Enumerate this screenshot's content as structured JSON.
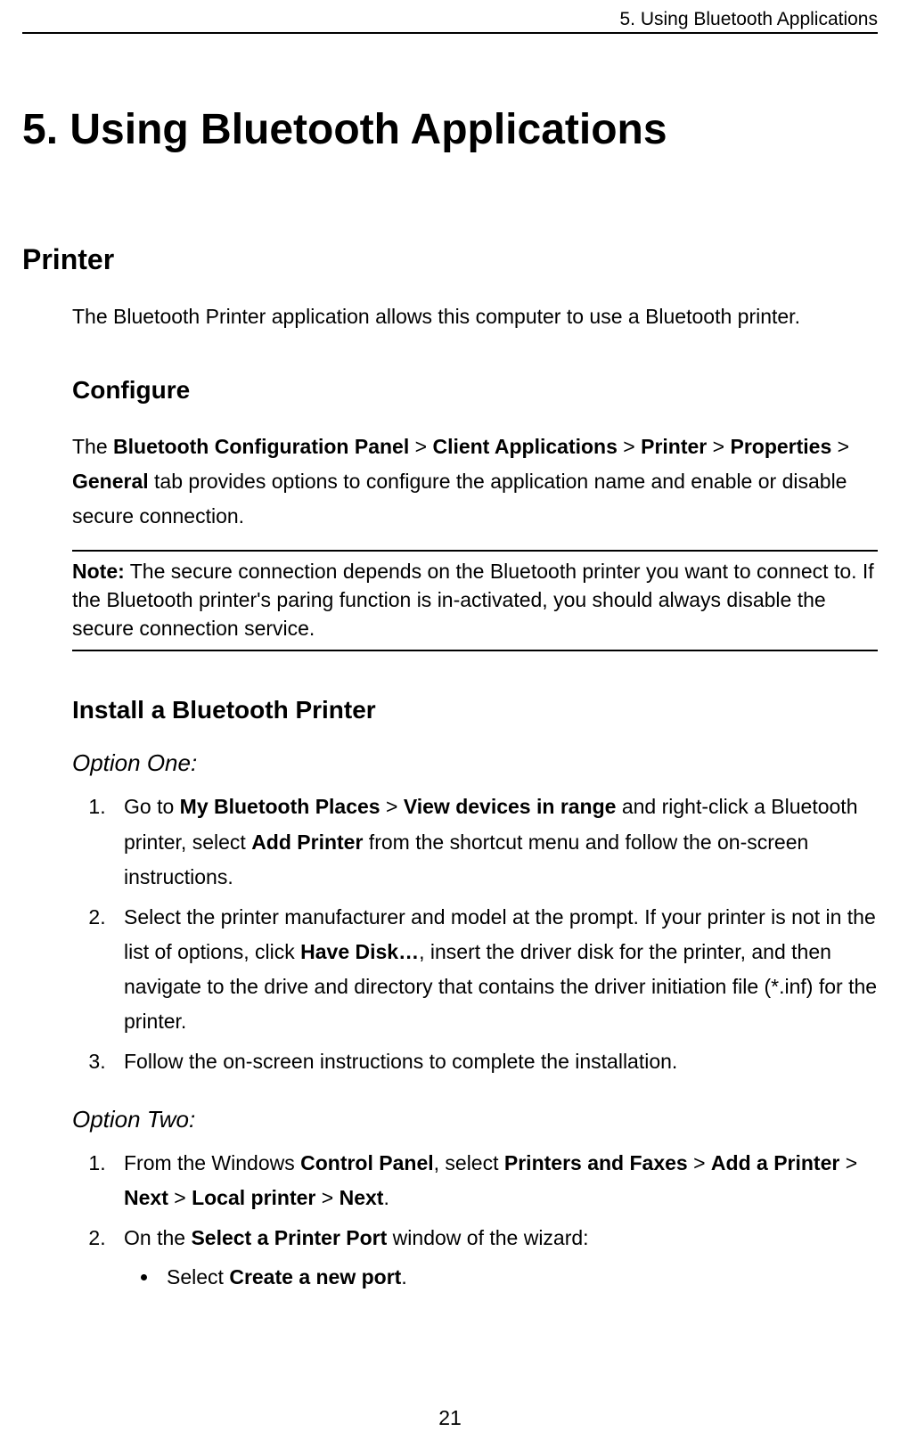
{
  "running_head": "5. Using Bluetooth Applications",
  "title": "5. Using Bluetooth Applications",
  "section_printer": "Printer",
  "printer_intro": "The Bluetooth Printer application allows this computer to use a Bluetooth printer.",
  "subsection_configure": "Configure",
  "configure_para": {
    "pre": "The ",
    "b1": "Bluetooth Configuration Panel",
    "gt1": " > ",
    "b2": "Client Applications",
    "gt2": " > ",
    "b3": "Printer",
    "gt3": " > ",
    "b4": "Properties",
    "gt4": " > ",
    "b5": "General",
    "post": " tab provides options to configure the application name and enable or disable secure connection."
  },
  "note": {
    "label": "Note:",
    "text": " The secure connection depends on the Bluetooth printer you want to connect to. If the Bluetooth printer's paring function is in-activated, you should always disable the secure connection service."
  },
  "subsection_install": "Install a Bluetooth Printer",
  "option_one": "Option One:",
  "opt1_step1": {
    "pre": "Go to ",
    "b1": "My Bluetooth Places",
    "gt1": " > ",
    "b2": "View devices in range",
    "mid": " and right-click a Bluetooth printer, select ",
    "b3": "Add Printer",
    "post": " from the shortcut menu and follow the on-screen instructions."
  },
  "opt1_step2": {
    "pre": "Select the printer manufacturer and model at the prompt. If your printer is not in the list of options, click ",
    "b1": "Have Disk…",
    "post": ", insert the driver disk for the printer, and then navigate to the drive and directory that contains the driver initiation file (*.inf) for the printer."
  },
  "opt1_step3": "Follow the on-screen instructions to complete the installation.",
  "option_two": "Option Two:",
  "opt2_step1": {
    "pre": "From the Windows ",
    "b1": "Control Panel",
    "mid1": ", select ",
    "b2": "Printers and Faxes",
    "gt1": " > ",
    "b3": "Add a Printer",
    "gt2": " > ",
    "b4": "Next",
    "gt3": " > ",
    "b5": "Local printer",
    "gt4": " > ",
    "b6": "Next",
    "post": "."
  },
  "opt2_step2": {
    "pre": "On the ",
    "b1": "Select a Printer Port",
    "post": " window of the wizard:"
  },
  "opt2_bullet1": {
    "pre": "Select ",
    "b1": "Create a new port",
    "post": "."
  },
  "page_number": "21"
}
